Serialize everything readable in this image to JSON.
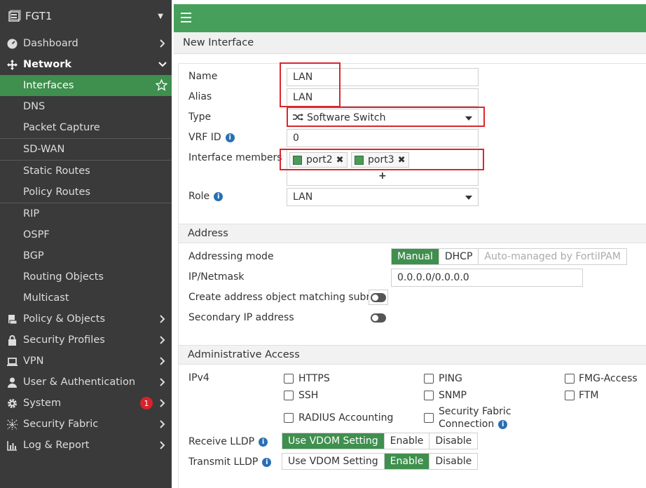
{
  "sidebar": {
    "device": "FGT1",
    "items": [
      {
        "label": "Dashboard"
      },
      {
        "label": "Network"
      },
      {
        "label": "Interfaces"
      },
      {
        "label": "DNS"
      },
      {
        "label": "Packet Capture"
      },
      {
        "label": "SD-WAN"
      },
      {
        "label": "Static Routes"
      },
      {
        "label": "Policy Routes"
      },
      {
        "label": "RIP"
      },
      {
        "label": "OSPF"
      },
      {
        "label": "BGP"
      },
      {
        "label": "Routing Objects"
      },
      {
        "label": "Multicast"
      },
      {
        "label": "Policy & Objects"
      },
      {
        "label": "Security Profiles"
      },
      {
        "label": "VPN"
      },
      {
        "label": "User & Authentication"
      },
      {
        "label": "System",
        "badge": "1"
      },
      {
        "label": "Security Fabric"
      },
      {
        "label": "Log & Report"
      }
    ]
  },
  "breadcrumb": "New Interface",
  "form": {
    "name_label": "Name",
    "name_value": "LAN",
    "alias_label": "Alias",
    "alias_value": "LAN",
    "type_label": "Type",
    "type_value": "Software Switch",
    "vrf_label": "VRF ID",
    "vrf_value": "0",
    "members_label": "Interface members",
    "members": [
      "port2",
      "port3"
    ],
    "add_symbol": "+",
    "role_label": "Role",
    "role_value": "LAN"
  },
  "address": {
    "title": "Address",
    "mode_label": "Addressing mode",
    "modes": [
      "Manual",
      "DHCP",
      "Auto-managed by FortiIPAM"
    ],
    "ipmask_label": "IP/Netmask",
    "ipmask_value": "0.0.0.0/0.0.0.0",
    "create_obj_label": "Create address object matching subnet",
    "secondary_label": "Secondary IP address"
  },
  "admin": {
    "title": "Administrative Access",
    "ipv4_label": "IPv4",
    "options": {
      "https": "HTTPS",
      "ping": "PING",
      "fmg": "FMG-Access",
      "ssh": "SSH",
      "snmp": "SNMP",
      "ftm": "FTM",
      "radius": "RADIUS Accounting",
      "sf_line1": "Security Fabric",
      "sf_line2": "Connection"
    },
    "receive_lldp_label": "Receive LLDP",
    "transmit_lldp_label": "Transmit LLDP",
    "lldp_options": [
      "Use VDOM Setting",
      "Enable",
      "Disable"
    ]
  },
  "colors": {
    "accent": "#46a05b",
    "active": "#3f8f4e",
    "sidebar": "#3a3a3a",
    "highlight": "#d9272e"
  }
}
